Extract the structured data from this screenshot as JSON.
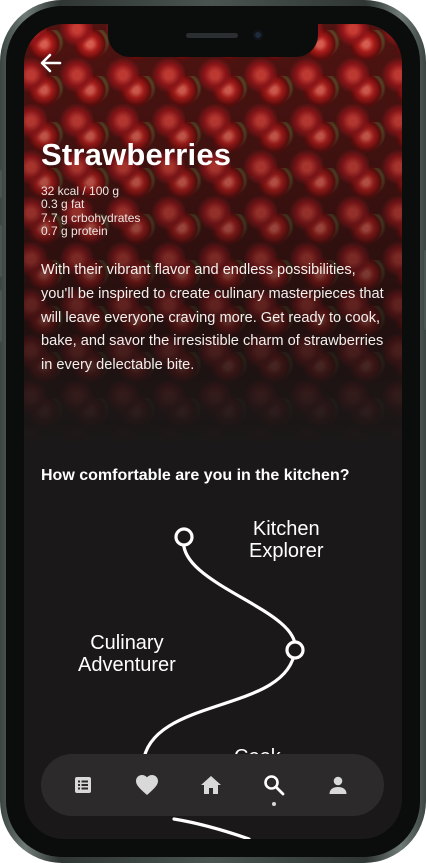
{
  "product": {
    "title": "Strawberries",
    "facts": [
      "32 kcal / 100 g",
      "0.3 g fat",
      "7.7 g crbohydrates",
      "0.7 g protein"
    ],
    "description": "With their vibrant flavor and endless possibilities, you'll be inspired to create culinary masterpieces that will leave everyone craving more. Get ready to cook, bake, and savor the irresistible charm of strawberries in every delectable bite."
  },
  "question": "How comfortable are you in the kitchen?",
  "levels": [
    {
      "line1": "Kitchen",
      "line2": "Explorer"
    },
    {
      "line1": "Culinary",
      "line2": "Adventurer"
    },
    {
      "line1": "Cook",
      "line2": ""
    }
  ],
  "icons": {
    "back": "arrow-left-icon",
    "nav": [
      "list-icon",
      "heart-icon",
      "home-icon",
      "search-icon",
      "profile-icon"
    ]
  },
  "nav": {
    "active": "search"
  },
  "colors": {
    "background": "#1a1818",
    "navbar": "#2c2a2a",
    "text": "#ffffff",
    "icon": "#d9d9d9"
  }
}
